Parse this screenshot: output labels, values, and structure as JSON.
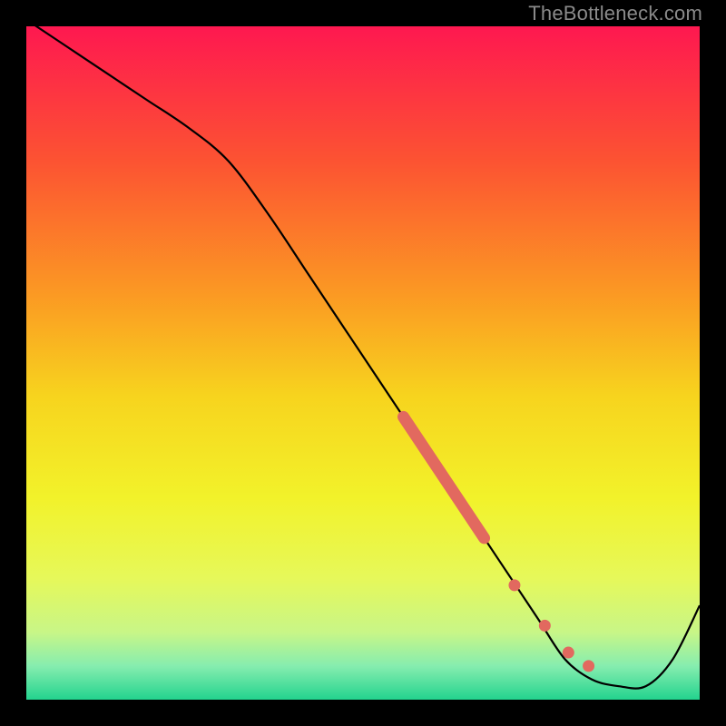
{
  "watermark": "TheBottleneck.com",
  "chart_data": {
    "type": "line",
    "title": "",
    "xlabel": "",
    "ylabel": "",
    "xlim": [
      0,
      100
    ],
    "ylim": [
      0,
      100
    ],
    "x": [
      0,
      6,
      12,
      18,
      24,
      30,
      36,
      42,
      48,
      54,
      60,
      64,
      68,
      72,
      76,
      80,
      84,
      88,
      92,
      96,
      100
    ],
    "values": [
      101,
      97,
      93,
      89,
      85,
      80,
      72,
      63,
      54,
      45,
      36,
      30,
      24,
      18,
      12,
      6,
      3,
      2,
      2,
      6,
      14
    ],
    "highlight_segments": [
      {
        "x0": 56,
        "y0": 42,
        "x1": 68,
        "y1": 24
      }
    ],
    "highlight_points": [
      {
        "x": 72.5,
        "y": 17
      },
      {
        "x": 77,
        "y": 11
      },
      {
        "x": 80.5,
        "y": 7
      },
      {
        "x": 83.5,
        "y": 5
      }
    ],
    "gradient_stops": [
      {
        "offset": 0.0,
        "color": "#fe1850"
      },
      {
        "offset": 0.2,
        "color": "#fc5332"
      },
      {
        "offset": 0.4,
        "color": "#fb9a23"
      },
      {
        "offset": 0.55,
        "color": "#f7d41e"
      },
      {
        "offset": 0.7,
        "color": "#f2f22a"
      },
      {
        "offset": 0.82,
        "color": "#e6f85a"
      },
      {
        "offset": 0.9,
        "color": "#c8f687"
      },
      {
        "offset": 0.95,
        "color": "#86edaf"
      },
      {
        "offset": 1.0,
        "color": "#23d38e"
      }
    ],
    "line_color": "#000000",
    "highlight_color": "#e2695f"
  }
}
